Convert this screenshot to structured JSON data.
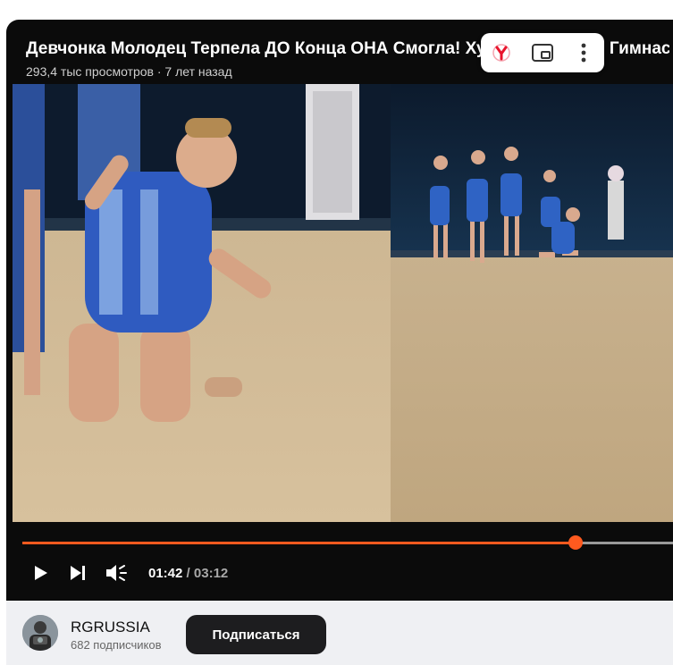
{
  "video": {
    "title": "Девчонка Молодец Терпела ДО Конца ОНА Смогла! Художественная Гимнастика",
    "meta": "293,4 тыс просмотров · 7 лет назад",
    "progress_fraction": 0.85,
    "current_time": "01:42",
    "separator": " / ",
    "duration": "03:12"
  },
  "overlay": {
    "browser_icon": "yandex-browser-icon",
    "pip_icon": "picture-in-picture-icon",
    "more_icon": "more-vertical-icon"
  },
  "controls": {
    "play_icon": "play-icon",
    "next_icon": "skip-next-icon",
    "volume_icon": "volume-icon"
  },
  "channel": {
    "name": "RGRUSSIA",
    "subscribers": "682 подписчиков",
    "subscribe_label": "Подписаться"
  },
  "colors": {
    "accent": "#ff5a1f",
    "player_bg": "#0b0b0b",
    "footer_bg": "#eff0f3",
    "button_bg": "#1d1d1f"
  }
}
